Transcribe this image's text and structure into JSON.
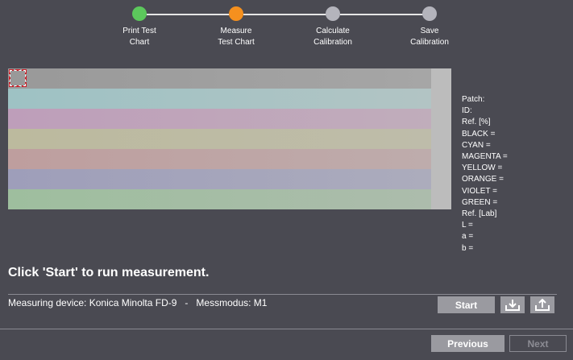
{
  "stepper": {
    "steps": [
      {
        "label": "Print Test\nChart",
        "state": "done",
        "color": "#5cc85c"
      },
      {
        "label": "Measure\nTest Chart",
        "state": "current",
        "color": "#f5901e"
      },
      {
        "label": "Calculate\nCalibration",
        "state": "pending",
        "color": "#b4b4bc"
      },
      {
        "label": "Save\nCalibration",
        "state": "pending",
        "color": "#b4b4bc"
      }
    ]
  },
  "chart": {
    "rows": [
      {
        "color": "#999999",
        "end_color": "#a6a6a6"
      },
      {
        "color": "#9ec2c4",
        "end_color": "#b2c4c4"
      },
      {
        "color": "#be9eba",
        "end_color": "#c0adbb"
      },
      {
        "color": "#bcba9e",
        "end_color": "#bebcaa"
      },
      {
        "color": "#be9e9e",
        "end_color": "#beacac"
      },
      {
        "color": "#9e9eba",
        "end_color": "#acacbc"
      },
      {
        "color": "#9ebe9e",
        "end_color": "#acbcac"
      }
    ]
  },
  "patch_info": {
    "patch": "Patch:",
    "id": "ID:",
    "ref_percent": "Ref. [%]",
    "black": "BLACK =",
    "cyan": "CYAN =",
    "magenta": "MAGENTA =",
    "yellow": "YELLOW =",
    "orange": "ORANGE =",
    "violet": "VIOLET =",
    "green": "GREEN =",
    "ref_lab": "Ref. [Lab]",
    "l": "L =",
    "a": "a =",
    "b": "b ="
  },
  "status": {
    "message": "Click 'Start' to run measurement."
  },
  "device": {
    "info": "Measuring device: Konica Minolta FD-9   -   Messmodus: M1"
  },
  "buttons": {
    "start": "Start",
    "import_icon": "import-icon",
    "export_icon": "export-icon",
    "previous": "Previous",
    "next": "Next"
  }
}
